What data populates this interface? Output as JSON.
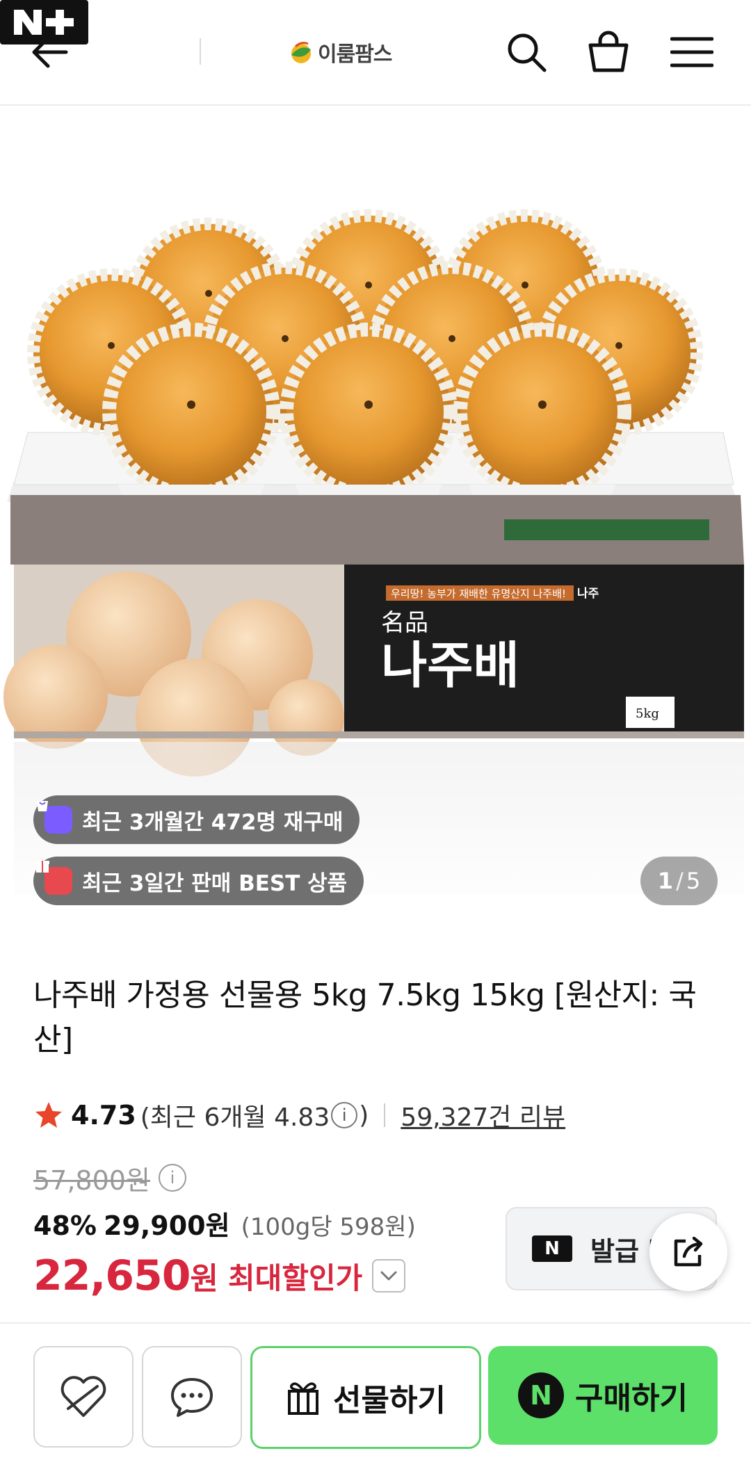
{
  "header": {
    "brand_name": "이룸팜스",
    "nplus_label": "N+"
  },
  "hero": {
    "box_tagline": "우리땅! 농부가 재배한 유명산지 나주배!",
    "box_brand": "나주",
    "box_subtitle": "名品",
    "box_title": "나주배",
    "box_weight": "5kg",
    "badges": {
      "repurchase": "최근 3개월간 472명 재구매",
      "best": "최근 3일간 판매 BEST 상품"
    },
    "pager": {
      "current": "1",
      "separator": "/",
      "total": "5"
    }
  },
  "product": {
    "title": "나주배 가정용 선물용 5kg 7.5kg 15kg [원산지: 국산]",
    "rating": {
      "score": "4.73",
      "recent_prefix": "(최근 6개월 4.83",
      "recent_suffix": ")",
      "info_glyph": "i",
      "reviews": "59,327건 리뷰"
    },
    "original_price": "57,800원",
    "discount_percent": "48%",
    "sale_price": "29,900원",
    "unit_price": "(100g당 598원)",
    "max_discount_price": "22,650",
    "max_discount_won": "원",
    "max_discount_label": "최대할인가"
  },
  "coupon": {
    "logo": "N",
    "label": "발급 받"
  },
  "bottom_bar": {
    "gift_label": "선물하기",
    "buy_label": "구매하기",
    "buy_logo": "N"
  },
  "colors": {
    "accent_red": "#d7263d",
    "buy_green": "#5de06a",
    "gift_border": "#5dd16b",
    "badge_purple": "#7b5cff",
    "badge_red": "#e8494f"
  }
}
